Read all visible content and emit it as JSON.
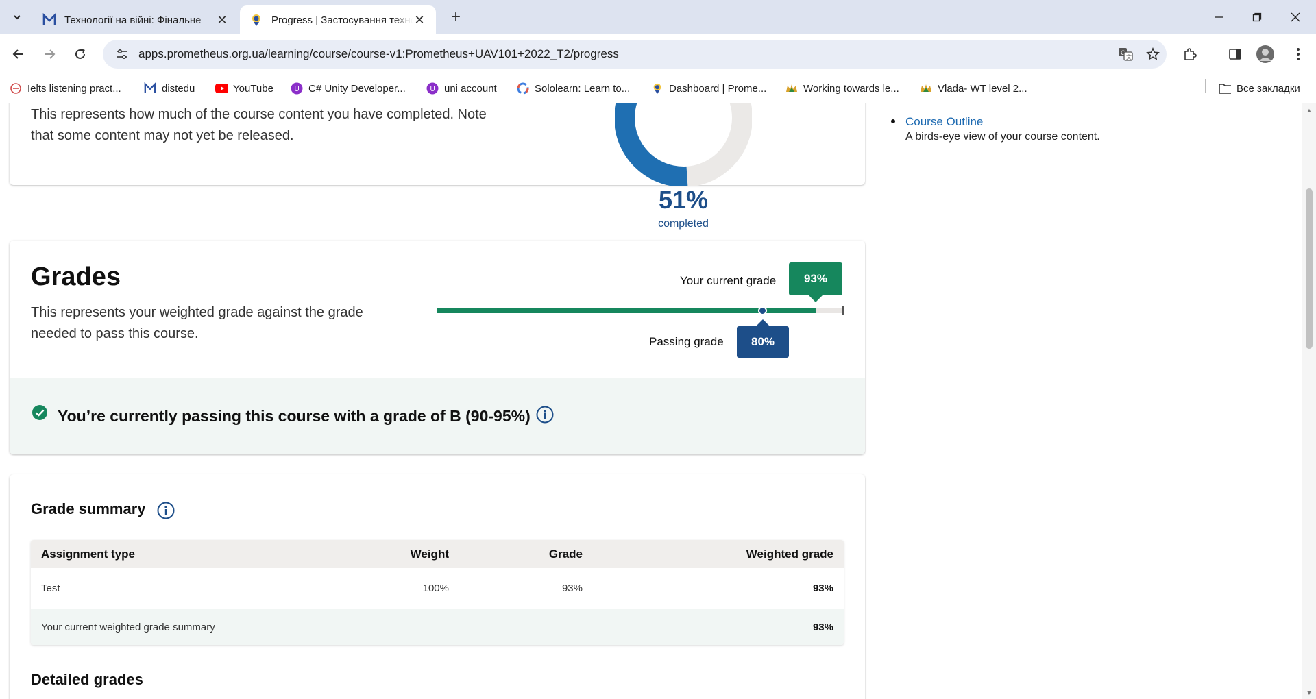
{
  "browser": {
    "tabs": [
      {
        "title": "Технології на війні: Фінальне",
        "active": false
      },
      {
        "title": "Progress | Застосування техно",
        "active": true
      }
    ],
    "url": "apps.prometheus.org.ua/learning/course/course-v1:Prometheus+UAV101+2022_T2/progress",
    "bookmarks": [
      "Ielts listening pract...",
      "distedu",
      "YouTube",
      "C# Unity Developer...",
      "uni account",
      "Sololearn: Learn to...",
      "Dashboard | Prome...",
      "Working towards le...",
      "Vlada- WT level 2..."
    ],
    "all_bookmarks": "Все закладки"
  },
  "completion": {
    "description": "This represents how much of the course content you have completed. Note that some content may not yet be released.",
    "percent": "51%",
    "label": "completed",
    "value": 0.51
  },
  "grades": {
    "title": "Grades",
    "description": "This represents your weighted grade against the grade needed to pass this course.",
    "current_label": "Your current grade",
    "current_value": "93%",
    "current_fraction": 0.93,
    "passing_label": "Passing grade",
    "passing_value": "80%",
    "passing_fraction": 0.8,
    "status": "You’re currently passing this course with a grade of B (90-95%)"
  },
  "summary": {
    "title": "Grade summary",
    "headers": [
      "Assignment type",
      "Weight",
      "Grade",
      "Weighted grade"
    ],
    "rows": [
      [
        "Test",
        "100%",
        "93%",
        "93%"
      ]
    ],
    "footer_label": "Your current weighted grade summary",
    "footer_value": "93%"
  },
  "detailed_title": "Detailed grades",
  "sidebar": {
    "link": "Course Outline",
    "description": "A birds-eye view of your course content."
  },
  "colors": {
    "green": "#16875d",
    "navy": "#1d4e89",
    "donut_track": "#ebe9e7"
  }
}
